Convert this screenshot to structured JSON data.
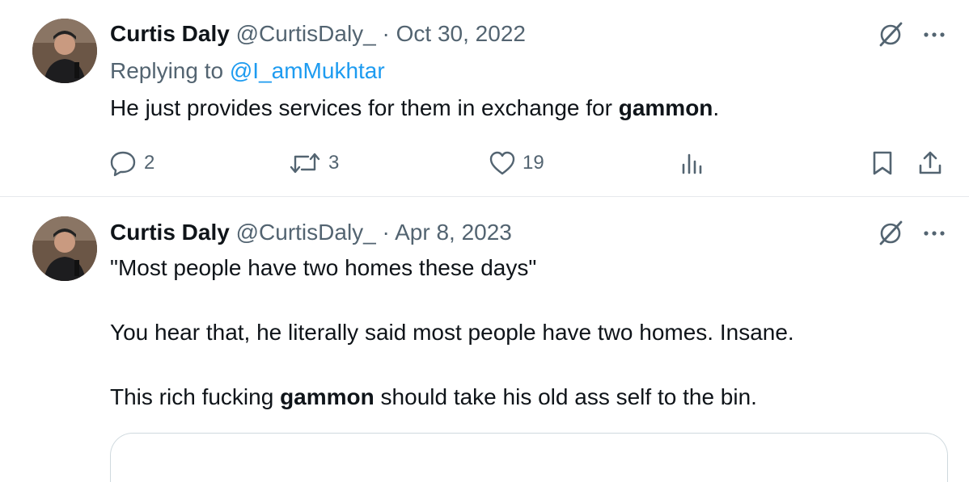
{
  "colors": {
    "text": "#0f1419",
    "secondary": "#536471",
    "link": "#1d9bf0",
    "divider": "#e6e9ec"
  },
  "tweets": [
    {
      "name": "Curtis Daly",
      "handle": "@CurtisDaly_",
      "dot": "·",
      "date": "Oct 30, 2022",
      "replying_prefix": "Replying to",
      "replying_to": "@I_amMukhtar",
      "text_before": "He just provides services for them in exchange for ",
      "text_bold": "gammon",
      "text_after": ".",
      "icons": {
        "top": [
          "grok-icon",
          "more-icon"
        ],
        "actions": [
          "reply-icon",
          "retweet-icon",
          "like-icon",
          "views-icon",
          "bookmark-icon",
          "share-icon"
        ]
      },
      "reply_count": "2",
      "retweet_count": "3",
      "like_count": "19"
    },
    {
      "name": "Curtis Daly",
      "handle": "@CurtisDaly_",
      "dot": "·",
      "date": "Apr 8, 2023",
      "line1": "\"Most people have two homes these days\"",
      "line2": "You hear that, he literally said most people have two homes. Insane.",
      "line3_before": "This rich fucking ",
      "line3_bold": "gammon",
      "line3_after": " should take his old ass self to the bin.",
      "icons": {
        "top": [
          "grok-icon",
          "more-icon"
        ]
      }
    }
  ]
}
